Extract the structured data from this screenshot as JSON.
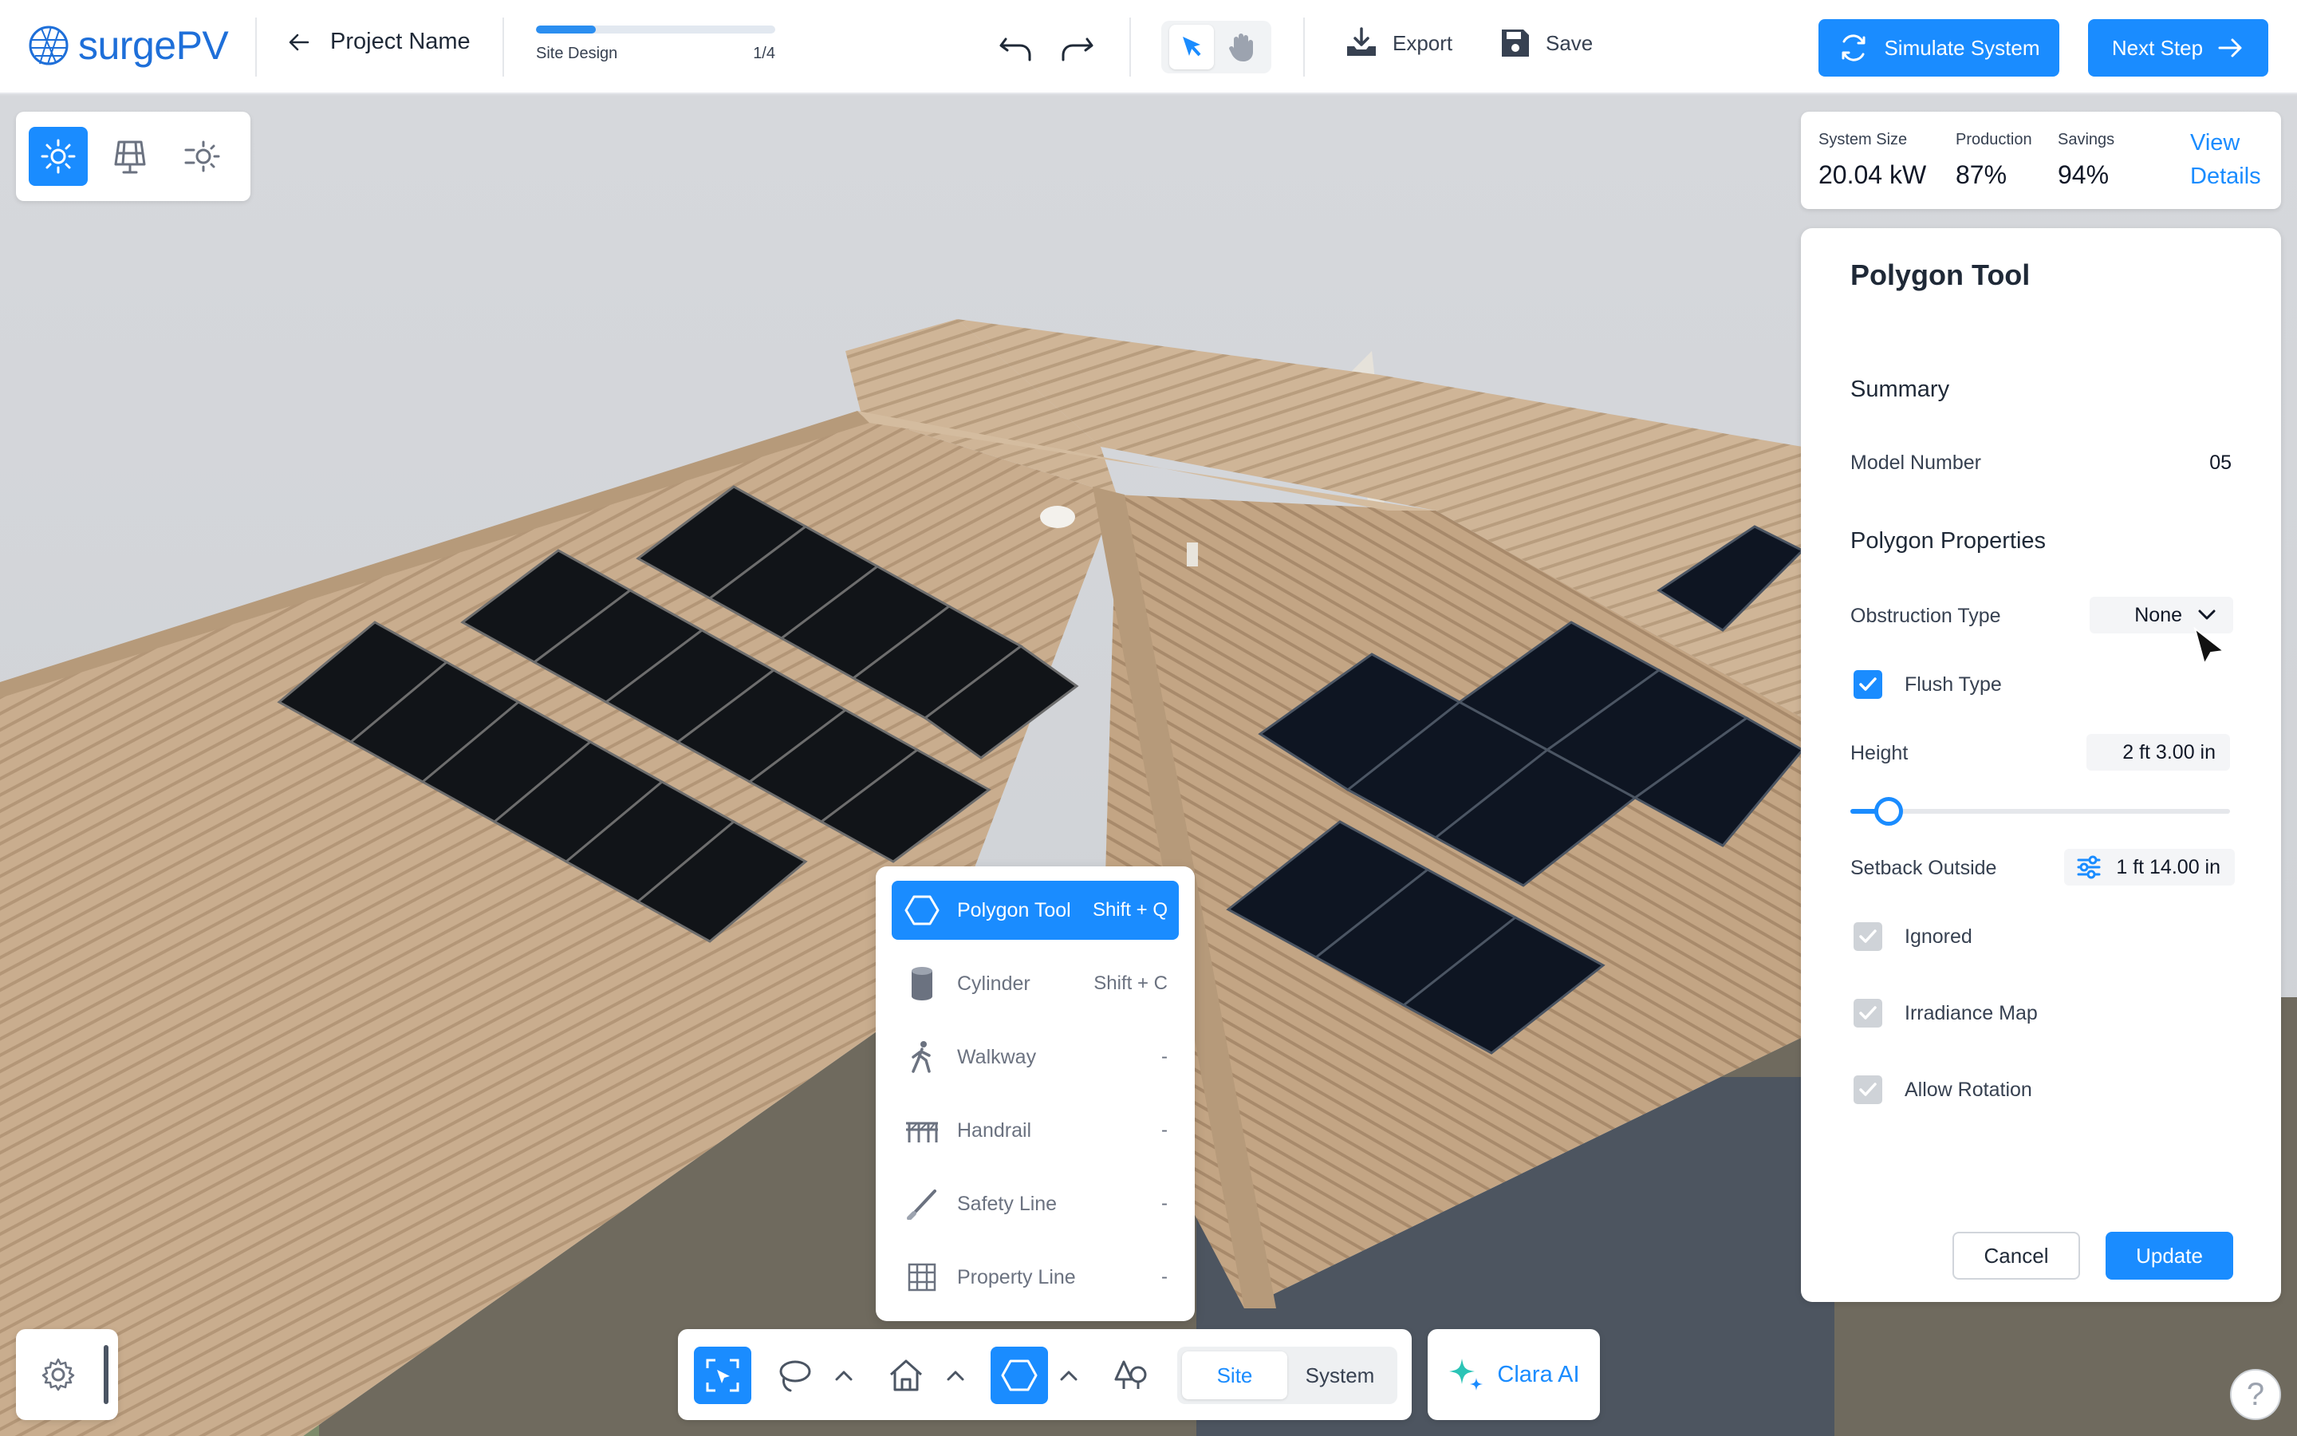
{
  "app": {
    "brand": "surgePV",
    "accent": "#1a8cff"
  },
  "header": {
    "project_name": "Project Name",
    "progress": {
      "label": "Site Design",
      "step": "1/4",
      "fraction": 0.25
    },
    "export_label": "Export",
    "save_label": "Save",
    "simulate_label": "Simulate System",
    "next_label": "Next Step"
  },
  "view_tools": [
    "sun-view-icon",
    "panel-grid-icon",
    "shade-icon"
  ],
  "stats": {
    "system_size": {
      "label": "System Size",
      "value": "20.04 kW"
    },
    "production": {
      "label": "Production",
      "value": "87%"
    },
    "savings": {
      "label": "Savings",
      "value": "94%"
    },
    "view_details_line1": "View",
    "view_details_line2": "Details"
  },
  "panel": {
    "title": "Polygon Tool",
    "summary_heading": "Summary",
    "model_number_label": "Model Number",
    "model_number_value": "05",
    "properties_heading": "Polygon Properties",
    "obstruction_label": "Obstruction Type",
    "obstruction_value": "None",
    "flush_label": "Flush Type",
    "flush_checked": true,
    "height_label": "Height",
    "height_value": "2 ft 3.00 in",
    "height_slider_fraction": 0.1,
    "setback_label": "Setback Outside",
    "setback_value": "1 ft 14.00 in",
    "ignored_label": "Ignored",
    "irradiance_label": "Irradiance Map",
    "rotation_label": "Allow Rotation",
    "cancel_label": "Cancel",
    "update_label": "Update"
  },
  "tool_menu": [
    {
      "label": "Polygon Tool",
      "shortcut": "Shift + Q",
      "icon": "hexagon-icon",
      "active": true
    },
    {
      "label": "Cylinder",
      "shortcut": "Shift + C",
      "icon": "cylinder-icon"
    },
    {
      "label": "Walkway",
      "shortcut": "-",
      "icon": "walkway-icon"
    },
    {
      "label": "Handrail",
      "shortcut": "-",
      "icon": "handrail-icon"
    },
    {
      "label": "Safety Line",
      "shortcut": "-",
      "icon": "safety-line-icon"
    },
    {
      "label": "Property Line",
      "shortcut": "-",
      "icon": "property-line-icon"
    }
  ],
  "bottom_bar": {
    "site_label": "Site",
    "system_label": "System",
    "clara_label": "Clara AI"
  },
  "help_label": "?"
}
